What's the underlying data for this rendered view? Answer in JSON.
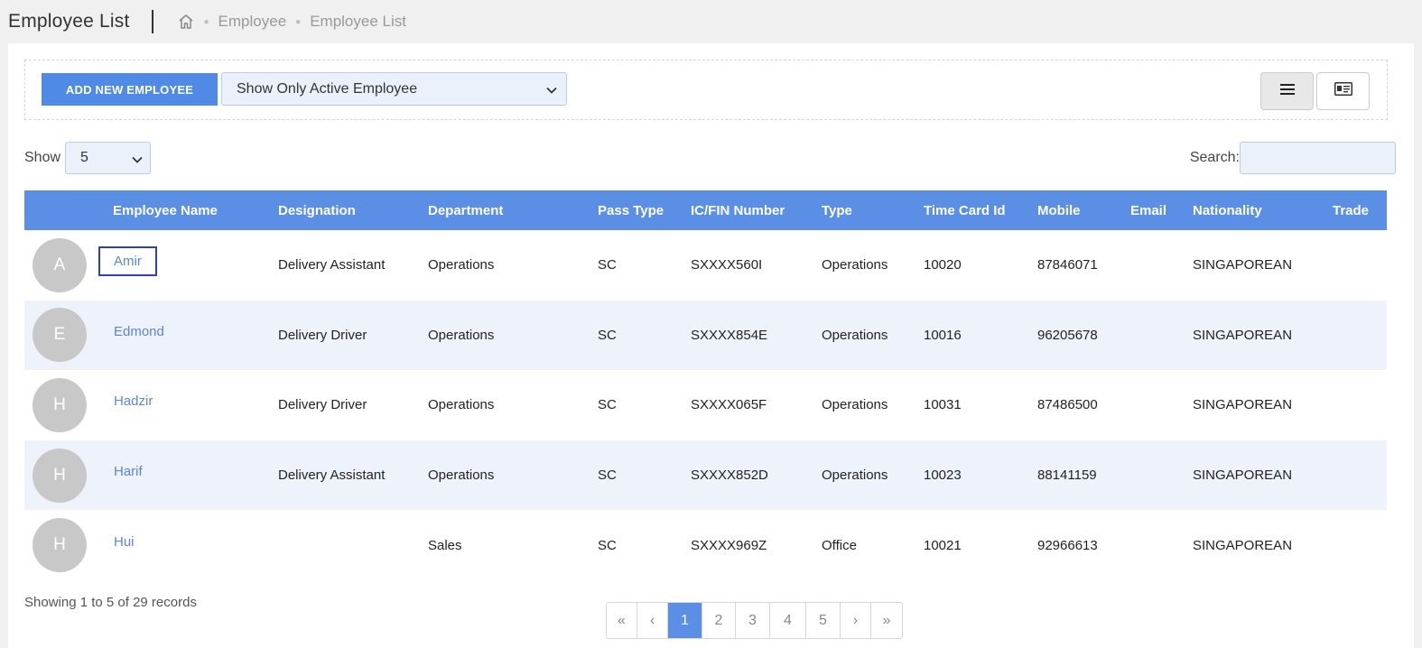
{
  "header": {
    "title": "Employee List",
    "breadcrumb": [
      "Employee",
      "Employee List"
    ]
  },
  "toolbar": {
    "add_label": "ADD NEW EMPLOYEE",
    "filter_value": "Show Only Active Employee"
  },
  "controls": {
    "show_label": "Show",
    "page_size": "5",
    "search_label": "Search:"
  },
  "table": {
    "columns": [
      "Employee Name",
      "Designation",
      "Department",
      "Pass Type",
      "IC/FIN Number",
      "Type",
      "Time Card Id",
      "Mobile",
      "Email",
      "Nationality",
      "Trade"
    ],
    "rows": [
      {
        "initial": "A",
        "name": "Amir",
        "designation": "Delivery Assistant",
        "department": "Operations",
        "pass_type": "SC",
        "ic": "SXXXX560I",
        "type": "Operations",
        "time_card": "10020",
        "mobile": "87846071",
        "email": "",
        "nationality": "SINGAPOREAN",
        "trade": ""
      },
      {
        "initial": "E",
        "name": "Edmond",
        "designation": "Delivery Driver",
        "department": "Operations",
        "pass_type": "SC",
        "ic": "SXXXX854E",
        "type": "Operations",
        "time_card": "10016",
        "mobile": "96205678",
        "email": "",
        "nationality": "SINGAPOREAN",
        "trade": ""
      },
      {
        "initial": "H",
        "name": "Hadzir",
        "designation": "Delivery Driver",
        "department": "Operations",
        "pass_type": "SC",
        "ic": "SXXXX065F",
        "type": "Operations",
        "time_card": "10031",
        "mobile": "87486500",
        "email": "",
        "nationality": "SINGAPOREAN",
        "trade": ""
      },
      {
        "initial": "H",
        "name": "Harif",
        "designation": "Delivery Assistant",
        "department": "Operations",
        "pass_type": "SC",
        "ic": "SXXXX852D",
        "type": "Operations",
        "time_card": "10023",
        "mobile": "88141159",
        "email": "",
        "nationality": "SINGAPOREAN",
        "trade": ""
      },
      {
        "initial": "H",
        "name": "Hui",
        "designation": "",
        "department": "Sales",
        "pass_type": "SC",
        "ic": "SXXXX969Z",
        "type": "Office",
        "time_card": "10021",
        "mobile": "92966613",
        "email": "",
        "nationality": "SINGAPOREAN",
        "trade": ""
      }
    ]
  },
  "footer": {
    "info": "Showing 1 to 5 of 29 records",
    "pages": [
      "«",
      "‹",
      "1",
      "2",
      "3",
      "4",
      "5",
      "›",
      "»"
    ],
    "active_page": "1"
  },
  "colors": {
    "accent": "#5b8fe6",
    "link": "#5a86d8",
    "avatar": "#c8c8c8"
  }
}
